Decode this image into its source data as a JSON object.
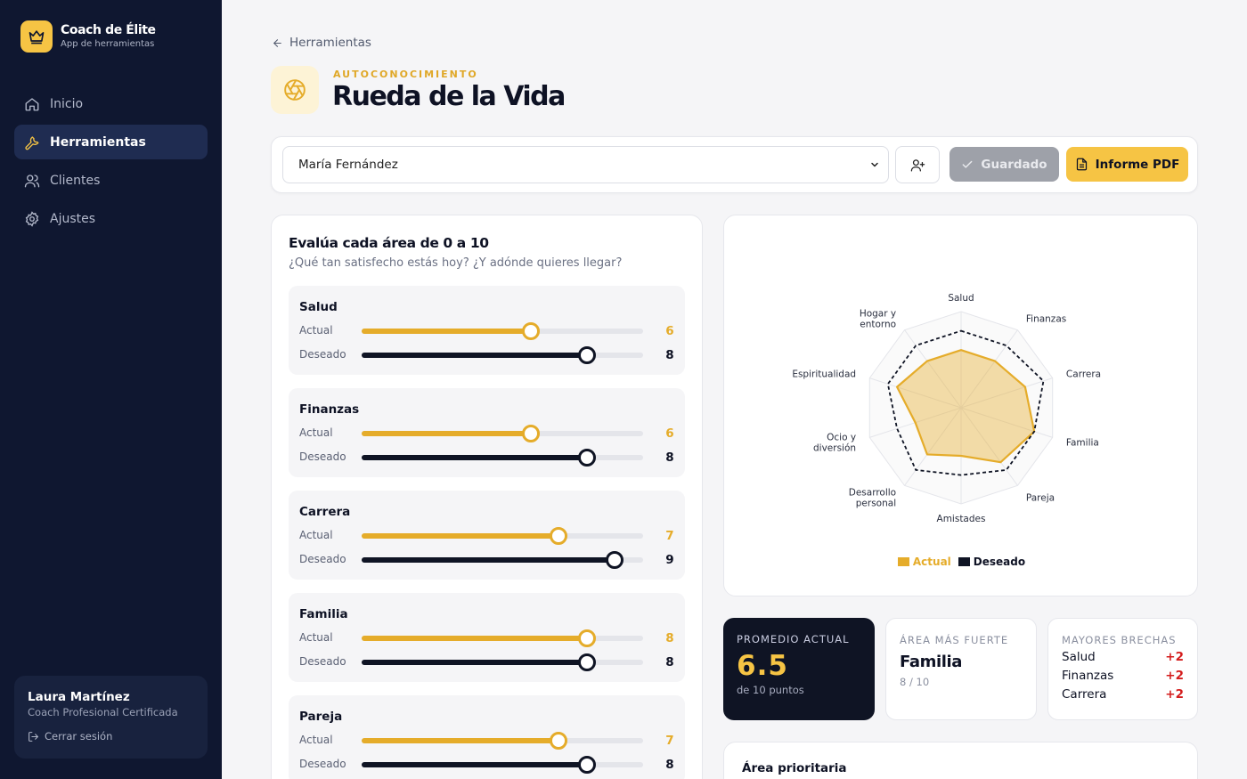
{
  "brand": {
    "title": "Coach de Élite",
    "subtitle": "App de herramientas",
    "icon": "crown-icon"
  },
  "nav": [
    {
      "label": "Inicio",
      "icon": "home-icon",
      "active": false
    },
    {
      "label": "Herramientas",
      "icon": "wrench-icon",
      "active": true
    },
    {
      "label": "Clientes",
      "icon": "users-icon",
      "active": false
    },
    {
      "label": "Ajustes",
      "icon": "gear-icon",
      "active": false
    }
  ],
  "user": {
    "name": "Laura Martínez",
    "role": "Coach Profesional Certificada",
    "logout": "Cerrar sesión"
  },
  "header": {
    "back": "Herramientas",
    "eyebrow": "AUTOCONOCIMIENTO",
    "title": "Rueda de la Vida",
    "icon": "aperture-icon"
  },
  "toolbar": {
    "client": "María Fernández",
    "saved": "Guardado",
    "pdf": "Informe PDF"
  },
  "sliders": {
    "title": "Evalúa cada área de 0 a 10",
    "subtitle": "¿Qué tan satisfecho estás hoy? ¿Y adónde quieres llegar?",
    "actual_label": "Actual",
    "desired_label": "Deseado",
    "max": 10,
    "areas": [
      {
        "name": "Salud",
        "actual": 6,
        "desired": 8
      },
      {
        "name": "Finanzas",
        "actual": 6,
        "desired": 8
      },
      {
        "name": "Carrera",
        "actual": 7,
        "desired": 9
      },
      {
        "name": "Familia",
        "actual": 8,
        "desired": 8
      },
      {
        "name": "Pareja",
        "actual": 7,
        "desired": 8
      }
    ]
  },
  "chart_data": {
    "type": "radar",
    "max": 10,
    "categories": [
      "Salud",
      "Finanzas",
      "Carrera",
      "Familia",
      "Pareja",
      "Amistades",
      "Desarrollo personal",
      "Ocio y diversión",
      "Espiritualidad",
      "Hogar y entorno"
    ],
    "series": [
      {
        "name": "Actual",
        "color": "#e5ac2a",
        "values": [
          6,
          6,
          7,
          8,
          7,
          5,
          6,
          5,
          7,
          6
        ]
      },
      {
        "name": "Deseado",
        "color": "#0f1424",
        "values": [
          8,
          8,
          9,
          8,
          8,
          7,
          8,
          7,
          8,
          8
        ]
      }
    ],
    "legend": [
      "Actual",
      "Deseado"
    ]
  },
  "stats": {
    "average": {
      "label": "PROMEDIO ACTUAL",
      "value": "6.5",
      "sub": "de 10 puntos"
    },
    "strongest": {
      "label": "ÁREA MÁS FUERTE",
      "value": "Familia",
      "sub": "8 / 10"
    },
    "gaps": {
      "label": "MAYORES BRECHAS",
      "items": [
        {
          "name": "Salud",
          "value": "+2"
        },
        {
          "name": "Finanzas",
          "value": "+2"
        },
        {
          "name": "Carrera",
          "value": "+2"
        }
      ]
    }
  },
  "priority": {
    "title": "Área prioritaria"
  }
}
